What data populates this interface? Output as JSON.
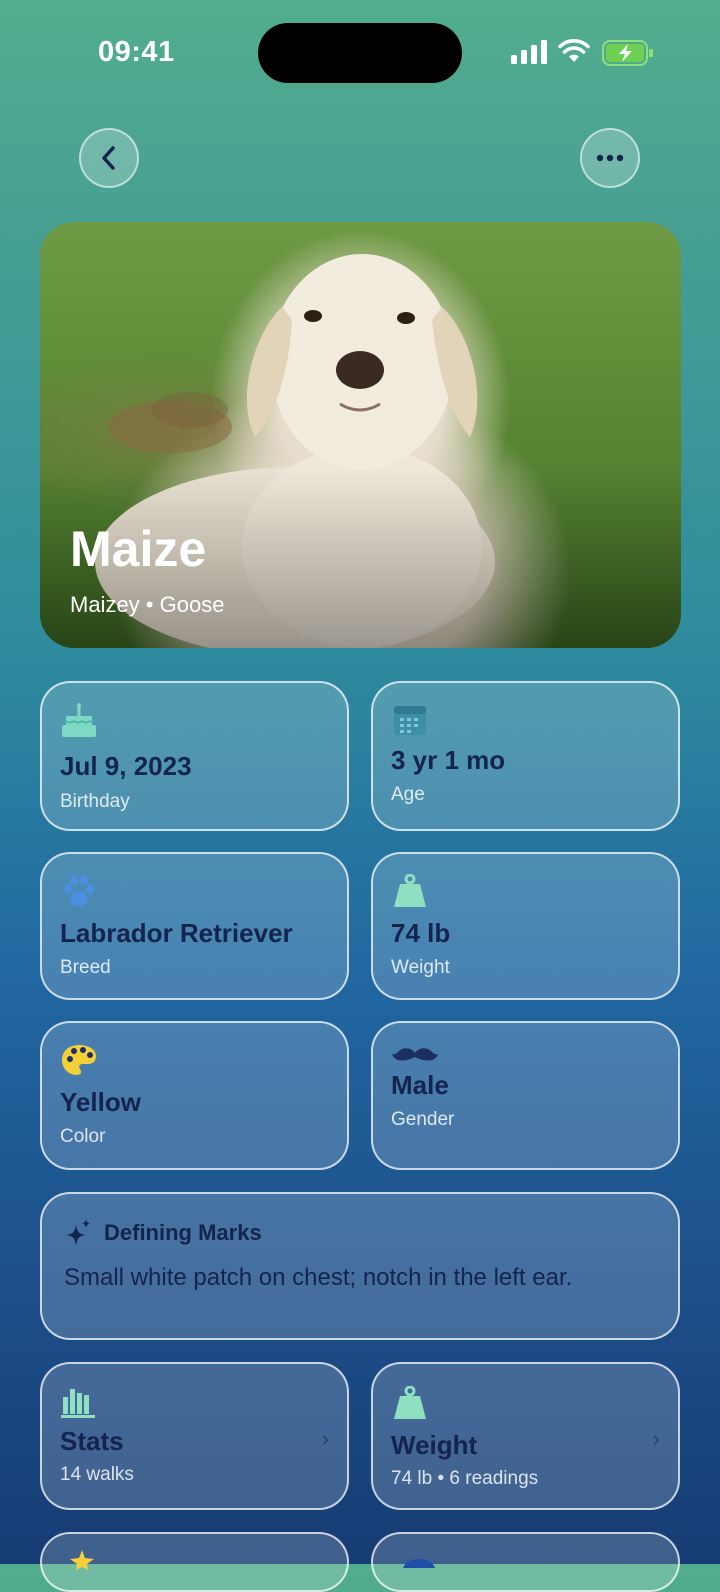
{
  "status_bar": {
    "time": "09:41"
  },
  "nav": {
    "back_icon": "chevron-left-icon",
    "more_icon": "ellipsis-icon"
  },
  "hero": {
    "name": "Maize",
    "nicknames": "Maizey • Goose"
  },
  "info_cards": [
    {
      "value": "Jul 9, 2023",
      "label": "Birthday",
      "icon": "cake-icon",
      "icon_color": "#7fd8c4"
    },
    {
      "value": "3 yr 1 mo",
      "label": "Age",
      "icon": "calendar-icon",
      "icon_color": "#3d8fa6"
    },
    {
      "value": "Labrador Retriever",
      "label": "Breed",
      "icon": "paw-icon",
      "icon_color": "#4a8fe0"
    },
    {
      "value": "74 lb",
      "label": "Weight",
      "icon": "weight-icon",
      "icon_color": "#8ee0c0"
    },
    {
      "value": "Yellow",
      "label": "Color",
      "icon": "palette-icon",
      "icon_color": "#f5cf3a"
    },
    {
      "value": "Male",
      "label": "Gender",
      "icon": "mustache-icon",
      "icon_color": "#1b2f63"
    }
  ],
  "defining_marks": {
    "title": "Defining Marks",
    "text": "Small white patch on chest; notch in the left ear.",
    "icon": "sparkles-icon"
  },
  "link_cards": [
    {
      "title": "Stats",
      "subtitle": "14 walks",
      "icon": "chart-bar-icon",
      "icon_color": "#8ee0c0"
    },
    {
      "title": "Weight",
      "subtitle": "74 lb • 6 readings",
      "icon": "weight-icon",
      "icon_color": "#8ee0c0"
    }
  ],
  "colors": {
    "text_dark": "#13244f",
    "card_border": "#ffffff"
  }
}
